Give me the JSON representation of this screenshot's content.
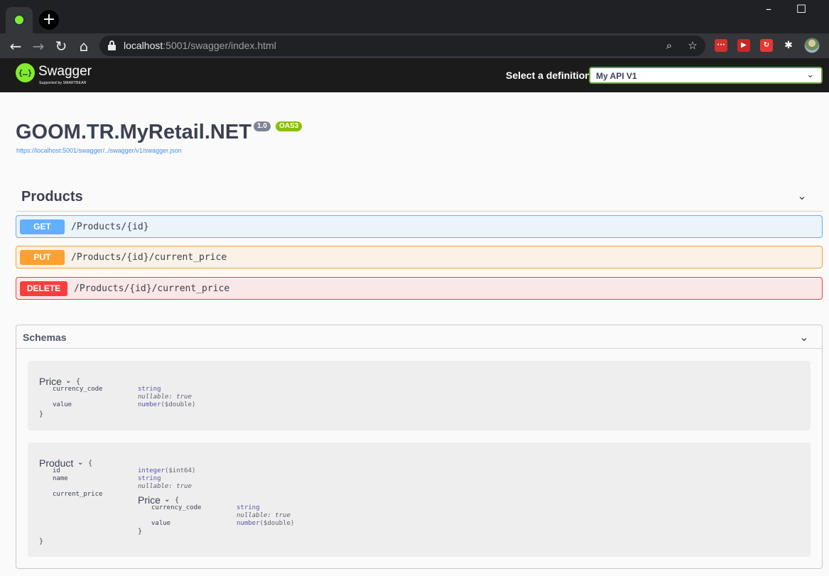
{
  "browser": {
    "new_tab": "+",
    "win_minimize": "–",
    "win_maximize": "☐",
    "url_host": "localhost",
    "url_rest": ":5001/swagger/index.html"
  },
  "swagger": {
    "logo_glyph": "{…}",
    "brand": "Swagger",
    "brand_sub": "Supported by SMARTBEAR",
    "definition_label": "Select a definition",
    "definition_value": "My API V1"
  },
  "info": {
    "title": "GOOM.TR.MyRetail.NET",
    "version": "1.0",
    "oas": "OAS3",
    "spec_url": "https://localhost:5001/swagger/../swagger/v1/swagger.json"
  },
  "tag": {
    "name": "Products",
    "operations": [
      {
        "method": "GET",
        "path": "/Products/{id}"
      },
      {
        "method": "PUT",
        "path": "/Products/{id}/current_price"
      },
      {
        "method": "DELETE",
        "path": "/Products/{id}/current_price"
      }
    ]
  },
  "schemas": {
    "title": "Schemas",
    "open_brace": "{",
    "close_brace": "}",
    "nullable": "nullable: true",
    "price": {
      "name": "Price",
      "props": [
        {
          "name": "currency_code",
          "type": "string"
        },
        {
          "name": "value",
          "type": "number",
          "format": "($double)"
        }
      ]
    },
    "product": {
      "name": "Product",
      "props": [
        {
          "name": "id",
          "type": "integer",
          "format": "($int64)"
        },
        {
          "name": "name",
          "type": "string"
        },
        {
          "name": "current_price",
          "type": "Price"
        }
      ]
    }
  },
  "colors": {
    "get": "#61affe",
    "put": "#fca130",
    "delete": "#f93e3e",
    "swagger_green": "#85ea2d",
    "oas_badge": "#89bf04"
  }
}
